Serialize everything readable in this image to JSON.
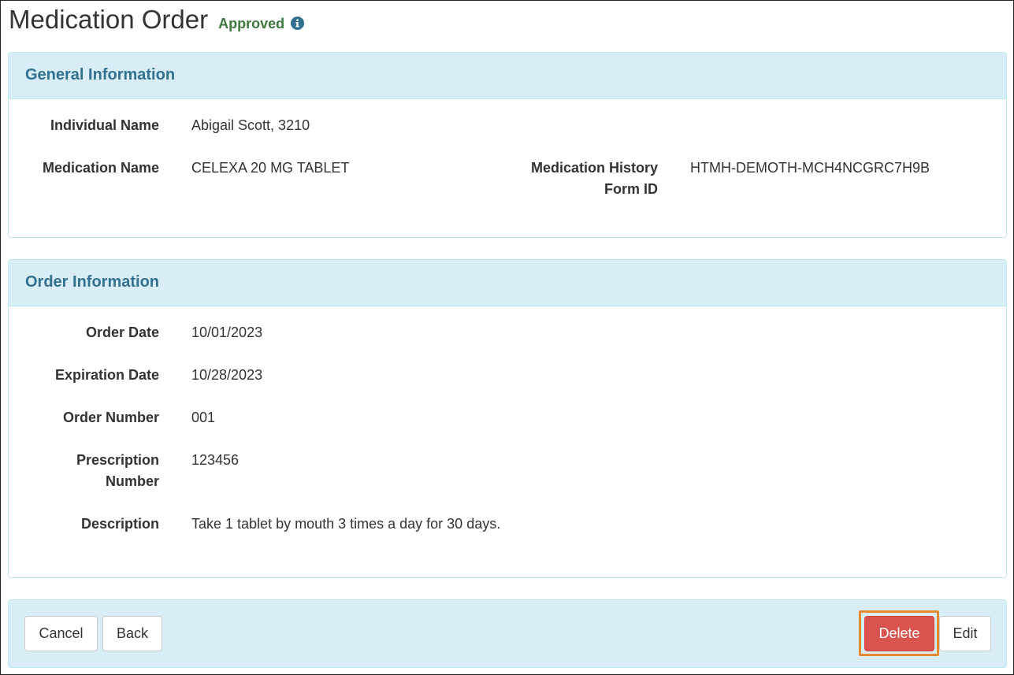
{
  "page": {
    "title": "Medication Order",
    "status": "Approved",
    "status_color": "#3c763d",
    "info_icon": "info-circle-icon",
    "info_icon_color": "#31708f"
  },
  "colors": {
    "panel_heading_bg": "#d9edf7",
    "panel_heading_text": "#31708f",
    "panel_border": "#bce8f1",
    "footer_bg": "#d9edf7",
    "danger": "#d9534f",
    "highlight": "#e58a2e"
  },
  "general": {
    "heading": "General Information",
    "fields": [
      {
        "label": "Individual Name",
        "value": "Abigail Scott, 3210"
      },
      {
        "label": "Medication Name",
        "value": "CELEXA 20 MG TABLET"
      },
      {
        "label": "Medication History Form ID",
        "label_line1": "Medication History",
        "label_line2": "Form ID",
        "value": "HTMH-DEMOTH-MCH4NCGRC7H9B"
      }
    ]
  },
  "order": {
    "heading": "Order Information",
    "fields": [
      {
        "label": "Order Date",
        "value": "10/01/2023"
      },
      {
        "label": "Expiration Date",
        "value": "10/28/2023"
      },
      {
        "label": "Order Number",
        "value": "001"
      },
      {
        "label": "Prescription Number",
        "label_line1": "Prescription",
        "label_line2": "Number",
        "value": "123456"
      },
      {
        "label": "Description",
        "value": "Take 1 tablet by mouth 3 times a day for 30 days."
      }
    ]
  },
  "actions": {
    "cancel": "Cancel",
    "back": "Back",
    "delete": "Delete",
    "edit": "Edit"
  }
}
